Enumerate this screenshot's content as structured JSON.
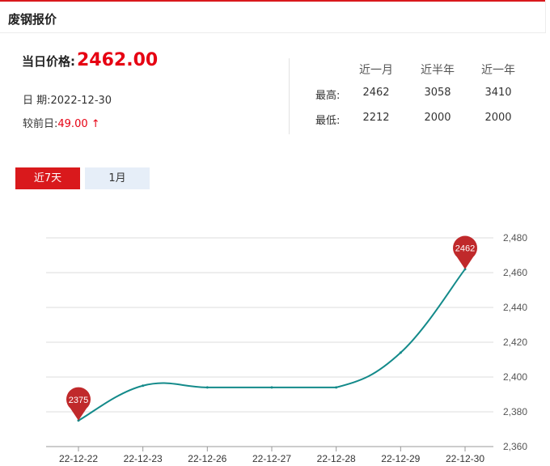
{
  "header": {
    "title": "废钢报价"
  },
  "today": {
    "label": "当日价格:",
    "value": "2462.00"
  },
  "info": {
    "date_label": "日 期:",
    "date_value": "2022-12-30",
    "change_label": "较前日:",
    "change_value": "49.00 ↑"
  },
  "stats": {
    "columns": [
      "近一月",
      "近半年",
      "近一年"
    ],
    "rows": [
      {
        "label": "最高:",
        "values": [
          "2462",
          "3058",
          "3410"
        ]
      },
      {
        "label": "最低:",
        "values": [
          "2212",
          "2000",
          "2000"
        ]
      }
    ]
  },
  "tabs": [
    {
      "label": "近7天",
      "active": true
    },
    {
      "label": "1月",
      "active": false
    }
  ],
  "colors": {
    "accent": "#d9191c",
    "line": "#138a8a",
    "pin": "#c0292b"
  },
  "chart_data": {
    "type": "line",
    "categories": [
      "22-12-22",
      "22-12-23",
      "22-12-26",
      "22-12-27",
      "22-12-28",
      "22-12-29",
      "22-12-30"
    ],
    "series": [
      {
        "values": [
          2375,
          2395,
          2394,
          2394,
          2394,
          2414,
          2462
        ]
      }
    ],
    "ylim": [
      2360,
      2480
    ],
    "yticks": [
      2360,
      2380,
      2400,
      2420,
      2440,
      2460,
      2480
    ],
    "ytick_labels": [
      "2,360",
      "2,380",
      "2,400",
      "2,420",
      "2,440",
      "2,460",
      "2,480"
    ],
    "markers": [
      {
        "index": 0,
        "label": "2375"
      },
      {
        "index": 6,
        "label": "2462"
      }
    ],
    "grid": true,
    "title": "",
    "xlabel": "",
    "ylabel": ""
  }
}
